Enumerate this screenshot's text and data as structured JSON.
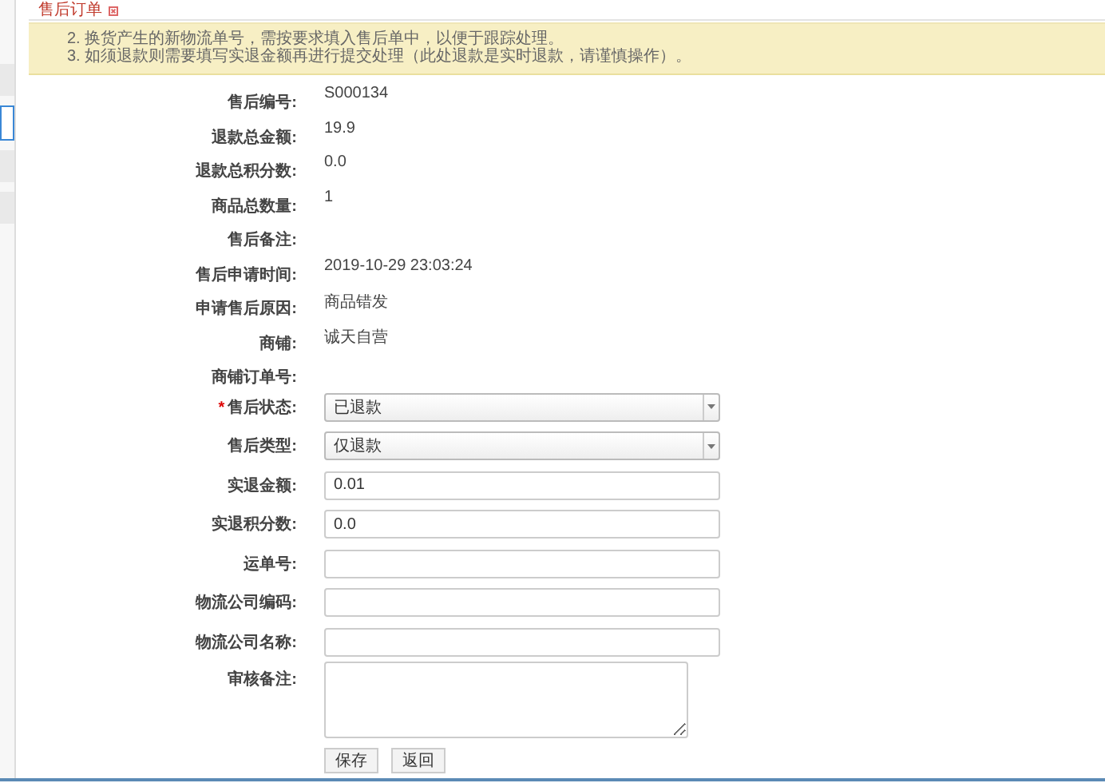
{
  "sidebar": {
    "items": [
      {
        "selected": false
      },
      {
        "selected": true
      },
      {
        "selected": false
      },
      {
        "selected": false
      }
    ]
  },
  "tab": {
    "title": "售后订单"
  },
  "notice": [
    "2. 换货产生的新物流单号，需按要求填入售后单中，以便于跟踪处理。",
    "3. 如须退款则需要填写实退金额再进行提交处理（此处退款是实时退款，请谨慎操作）。"
  ],
  "fields": [
    {
      "kind": "text",
      "label": "售后编号:",
      "value": "S000134"
    },
    {
      "kind": "text",
      "label": "退款总金额:",
      "value": "19.9"
    },
    {
      "kind": "text",
      "label": "退款总积分数:",
      "value": "0.0"
    },
    {
      "kind": "text",
      "label": "商品总数量:",
      "value": "1"
    },
    {
      "kind": "text",
      "label": "售后备注:"
    },
    {
      "kind": "text",
      "label": "售后申请时间:",
      "value": "2019-10-29 23:03:24"
    },
    {
      "kind": "text",
      "label": "申请售后原因:",
      "value": "商品错发"
    },
    {
      "kind": "text",
      "label": "商铺:",
      "value": "诚天自营"
    },
    {
      "kind": "text",
      "label": "商铺订单号:"
    },
    {
      "kind": "select",
      "label": "售后状态:",
      "value": "已退款",
      "required_mark": "*"
    },
    {
      "kind": "select",
      "label": "售后类型:",
      "value": "仅退款"
    },
    {
      "kind": "input",
      "label": "实退金额:",
      "value": "0.01"
    },
    {
      "kind": "input",
      "label": "实退积分数:",
      "value": "0.0"
    },
    {
      "kind": "input",
      "label": "运单号:"
    },
    {
      "kind": "input",
      "label": "物流公司编码:"
    },
    {
      "kind": "input",
      "label": "物流公司名称:"
    },
    {
      "kind": "textarea",
      "label": "审核备注:"
    }
  ],
  "buttons": [
    "保存",
    "返回"
  ]
}
